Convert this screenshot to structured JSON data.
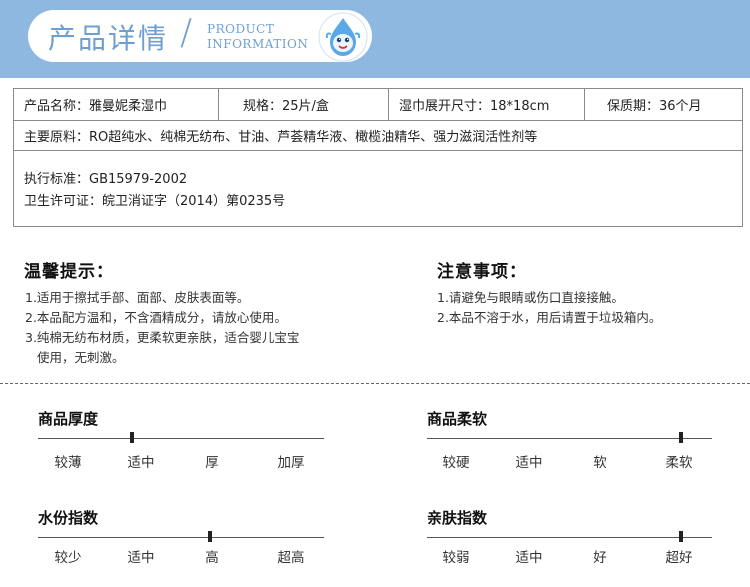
{
  "header": {
    "title": "产品详情",
    "en_line1": "PRODUCT",
    "en_line2": "INFORMATION",
    "mascot_icon": "water-drop-mascot-icon",
    "band_color": "#8fb8e0",
    "accent_color": "#6f9fd0"
  },
  "info": {
    "name": "产品名称：雅曼妮柔湿巾",
    "spec": "规格：25片/盒",
    "size": "湿巾展开尺寸：18*18cm",
    "shelf_life": "保质期：36个月",
    "ingredients": "主要原料：RO超纯水、纯棉无纺布、甘油、芦荟精华液、橄榄油精华、强力滋润活性剂等",
    "standard": "执行标准：GB15979-2002",
    "permit": "卫生许可证：皖卫消证字（2014）第0235号"
  },
  "tips_left": {
    "title": "温馨提示：",
    "items": [
      "1.适用于擦拭手部、面部、皮肤表面等。",
      "2.本品配方温和，不含酒精成分，请放心使用。",
      "3.纯棉无纺布材质，更柔软更亲肤，适合婴儿宝宝",
      "使用，无刺激。"
    ]
  },
  "tips_right": {
    "title": "注意事项：",
    "items": [
      "1.请避免与眼睛或伤口直接接触。",
      "2.本品不溶于水，用后请置于垃圾箱内。"
    ]
  },
  "scales": {
    "thickness": {
      "title": "商品厚度",
      "labels": [
        "较薄",
        "适中",
        "厚",
        "加厚"
      ],
      "level": 0.33
    },
    "softness": {
      "title": "商品柔软",
      "labels": [
        "较硬",
        "适中",
        "软",
        "柔软"
      ],
      "level": 0.89
    },
    "water": {
      "title": "水份指数",
      "labels": [
        "较少",
        "适中",
        "高",
        "超高"
      ],
      "level": 0.6
    },
    "skin": {
      "title": "亲肤指数",
      "labels": [
        "较弱",
        "适中",
        "好",
        "超好"
      ],
      "level": 0.89
    }
  }
}
